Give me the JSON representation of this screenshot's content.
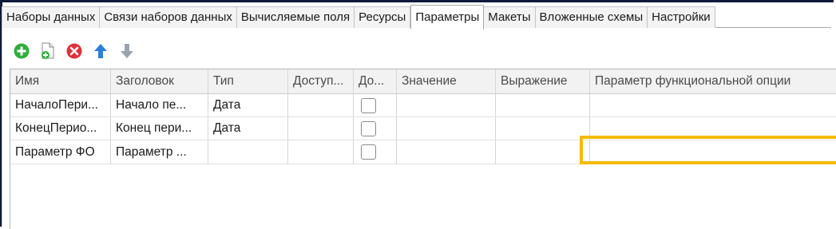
{
  "tabs": [
    {
      "label": "Наборы данных"
    },
    {
      "label": "Связи наборов данных"
    },
    {
      "label": "Вычисляемые поля"
    },
    {
      "label": "Ресурсы"
    },
    {
      "label": "Параметры",
      "active": true
    },
    {
      "label": "Макеты"
    },
    {
      "label": "Вложенные схемы"
    },
    {
      "label": "Настройки"
    }
  ],
  "toolbar": {
    "icons": [
      "add-icon",
      "new-document-icon",
      "delete-icon",
      "move-up-icon",
      "move-down-icon"
    ]
  },
  "table": {
    "columns": [
      "Имя",
      "Заголовок",
      "Тип",
      "Доступ...",
      "До...",
      "Значение",
      "Выражение",
      "Параметр функциональной опции"
    ],
    "rows": [
      {
        "name": "НачалоПери...",
        "title": "Начало пе...",
        "type": "Дата",
        "access": "",
        "checked": false,
        "value": "",
        "expression": "",
        "fo_param": ""
      },
      {
        "name": "КонецПерио...",
        "title": "Конец пери...",
        "type": "Дата",
        "access": "",
        "checked": false,
        "value": "",
        "expression": "",
        "fo_param": ""
      },
      {
        "name": "Параметр ФО",
        "title": "Параметр ...",
        "type": "",
        "access": "",
        "checked": false,
        "value": "",
        "expression": "",
        "fo_param": ""
      }
    ]
  },
  "colors": {
    "highlight": "#f5bb00",
    "frame": "#0d1b3a",
    "add": "#2fae3a",
    "delete": "#e0303a",
    "up": "#2a7fd9"
  }
}
